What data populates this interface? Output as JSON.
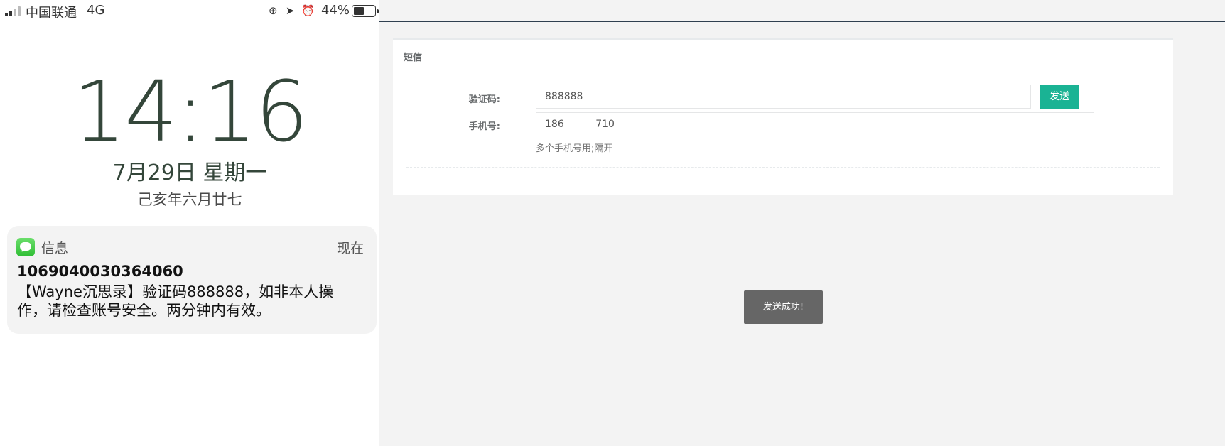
{
  "phone": {
    "status_bar": {
      "carrier": "中国联通",
      "network": "4G",
      "battery_percent": "44%",
      "battery_level": 0.44,
      "icons": [
        "rotation-lock-icon",
        "location-arrow-icon",
        "alarm-icon"
      ]
    },
    "lock_screen": {
      "time": "14:16",
      "date": "7月29日 星期一",
      "lunar_date": "己亥年六月廿七"
    },
    "notification": {
      "app_name": "信息",
      "time": "现在",
      "sender": "1069040030364060",
      "message": "【Wayne沉思录】验证码888888，如非本人操作，请检查账号安全。两分钟内有效。"
    }
  },
  "web": {
    "panel_title": "短信",
    "form": {
      "code_label": "验证码:",
      "code_value": "888888",
      "send_button": "发送",
      "phone_label": "手机号:",
      "phone_value": "186          710",
      "phone_help": "多个手机号用;隔开"
    },
    "toast": "发送成功!",
    "colors": {
      "primary": "#1ab394",
      "toast_bg": "#666666",
      "page_bg": "#f3f3f3"
    }
  }
}
